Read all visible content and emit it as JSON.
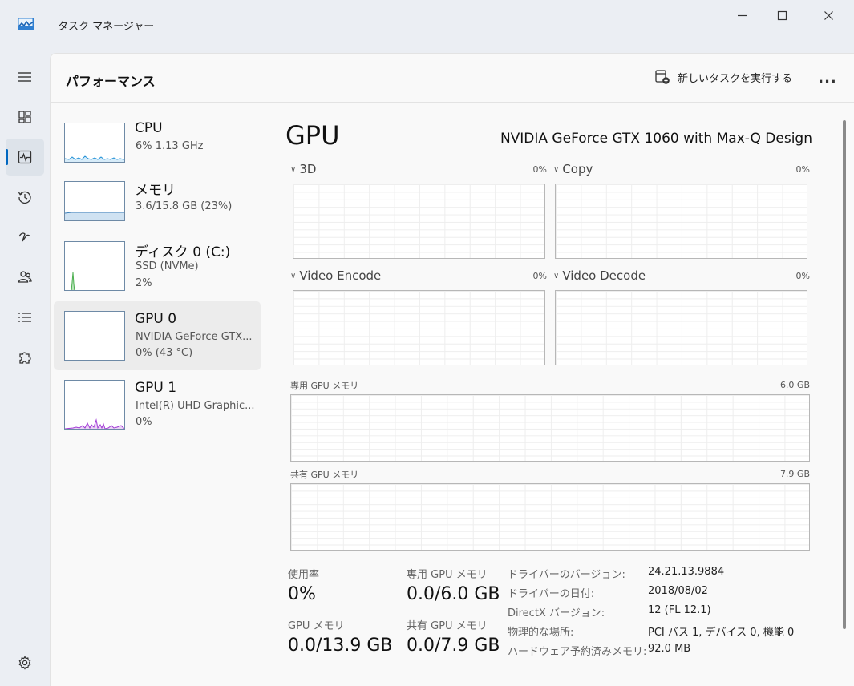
{
  "window": {
    "title": "タスク マネージャー"
  },
  "header": {
    "page_title": "パフォーマンス",
    "run_task_label": "新しいタスクを実行する",
    "more_label": "..."
  },
  "colors": {
    "accent": "#0067c0",
    "cpu": "#1e8fd6",
    "memory": "#3c7fb8",
    "disk": "#4caf50",
    "gpu1": "#a13bd6"
  },
  "devices": [
    {
      "name": "CPU",
      "line1": "6%  1.13 GHz",
      "line2": ""
    },
    {
      "name": "メモリ",
      "line1": "3.6/15.8 GB (23%)",
      "line2": ""
    },
    {
      "name": "ディスク 0 (C:)",
      "line1": "SSD (NVMe)",
      "line2": "2%"
    },
    {
      "name": "GPU 0",
      "line1": "NVIDIA GeForce GTX...",
      "line2": "0% (43 °C)"
    },
    {
      "name": "GPU 1",
      "line1": "Intel(R) UHD Graphic...",
      "line2": "0%"
    }
  ],
  "gpu": {
    "title": "GPU",
    "model": "NVIDIA GeForce GTX 1060 with Max-Q Design",
    "engines": [
      {
        "name": "3D",
        "pct": "0%"
      },
      {
        "name": "Copy",
        "pct": "0%"
      },
      {
        "name": "Video Encode",
        "pct": "0%"
      },
      {
        "name": "Video Decode",
        "pct": "0%"
      }
    ],
    "dedicated_label": "専用 GPU メモリ",
    "dedicated_max": "6.0 GB",
    "shared_label": "共有 GPU メモリ",
    "shared_max": "7.9 GB"
  },
  "stats": {
    "usage_label": "使用率",
    "usage_value": "0%",
    "ded_label": "専用 GPU メモリ",
    "ded_value": "0.0/6.0 GB",
    "gpu_mem_label": "GPU メモリ",
    "gpu_mem_value": "0.0/13.9 GB",
    "shared_label": "共有 GPU メモリ",
    "shared_value": "0.0/7.9 GB"
  },
  "properties": [
    {
      "key": "ドライバーのバージョン:",
      "value": "24.21.13.9884"
    },
    {
      "key": "ドライバーの日付:",
      "value": "2018/08/02"
    },
    {
      "key": "DirectX バージョン:",
      "value": "12 (FL 12.1)"
    },
    {
      "key": "物理的な場所:",
      "value": "PCI バス 1, デバイス 0, 機能 0"
    },
    {
      "key": "ハードウェア予約済みメモリ:",
      "value": "92.0 MB"
    }
  ]
}
